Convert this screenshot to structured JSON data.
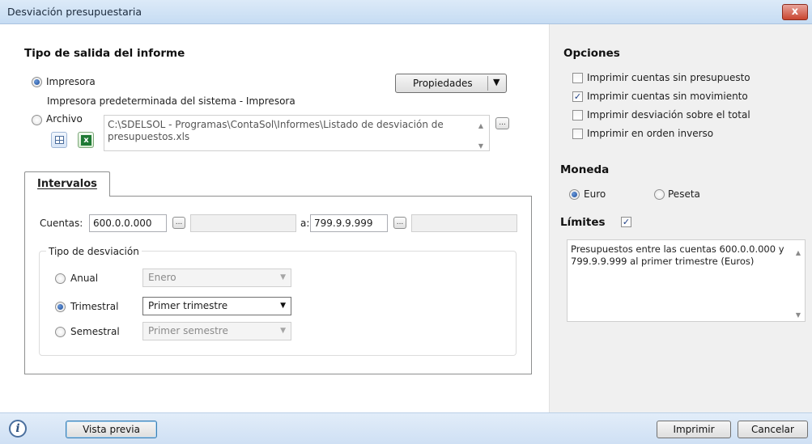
{
  "window": {
    "title": "Desviación presupuestaria",
    "close_glyph": "x"
  },
  "output": {
    "section_title": "Tipo de salida del informe",
    "printer_label": "Impresora",
    "printer_desc": "Impresora predeterminada del sistema - Impresora",
    "properties_label": "Propiedades",
    "file_label": "Archivo",
    "file_path_line1": "C:\\SDELSOL - Programas\\ContaSol\\Informes\\Listado de desviación de",
    "file_path_line2": "presupuestos.xls",
    "browse_glyph": "..."
  },
  "intervals": {
    "tab_label": "Intervalos",
    "accounts_label": "Cuentas:",
    "from_value": "600.0.0.000",
    "to_label": "a:",
    "to_value": "799.9.9.999",
    "deviation_group_title": "Tipo de desviación",
    "annual_label": "Anual",
    "annual_value": "Enero",
    "quarterly_label": "Trimestral",
    "quarterly_value": "Primer trimestre",
    "semiannual_label": "Semestral",
    "semiannual_value": "Primer semestre"
  },
  "options": {
    "title": "Opciones",
    "items": [
      {
        "label": "Imprimir cuentas sin presupuesto",
        "checked": false
      },
      {
        "label": "Imprimir cuentas sin movimiento",
        "checked": true
      },
      {
        "label": "Imprimir desviación sobre el total",
        "checked": false
      },
      {
        "label": "Imprimir en orden inverso",
        "checked": false
      }
    ]
  },
  "currency": {
    "title": "Moneda",
    "euro_label": "Euro",
    "peseta_label": "Peseta",
    "selected": "Euro"
  },
  "limits": {
    "title": "Límites",
    "checked": true,
    "description": "Presupuestos entre las cuentas 600.0.0.000 y 799.9.9.999 al primer trimestre (Euros)"
  },
  "footer": {
    "preview_label": "Vista previa",
    "print_label": "Imprimir",
    "cancel_label": "Cancelar",
    "info_glyph": "i"
  },
  "icons": {
    "file_type_1": "spreadsheet-icon",
    "file_type_2": "excel-icon",
    "info": "info-icon"
  },
  "colors": {
    "titlebar": "#c6dcf3",
    "footer": "#cfe0f4",
    "right_panel": "#f0f0f0",
    "radio_accent": "#1d4e9d"
  }
}
